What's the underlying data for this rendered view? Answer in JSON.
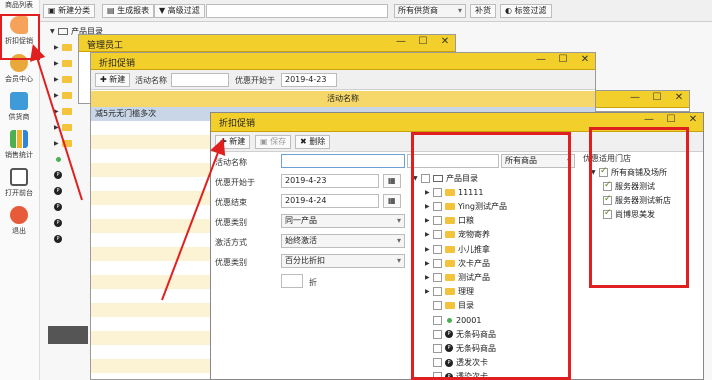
{
  "sidebar": {
    "items": [
      {
        "label": "商品列表",
        "icon": "goods-list-icon"
      },
      {
        "label": "折扣促销",
        "icon": "discount-tag-icon"
      },
      {
        "label": "会员中心",
        "icon": "member-icon"
      },
      {
        "label": "供货商",
        "icon": "supplier-icon"
      },
      {
        "label": "销售统计",
        "icon": "sales-chart-icon"
      },
      {
        "label": "打开前台",
        "icon": "pos-terminal-icon"
      },
      {
        "label": "退出",
        "icon": "power-icon"
      }
    ]
  },
  "main_toolbar": {
    "new_category": "新建分类",
    "generate_report": "生成报表",
    "advanced_filter": "高级过滤",
    "supplier_select": "所有供货商",
    "replenish": "补货",
    "tag_filter": "标签过滤"
  },
  "main_tree": {
    "root": "产品目录"
  },
  "staff_window": {
    "title": "管理员工"
  },
  "promo_window_back": {
    "title": "折扣促销",
    "new_button": "新建",
    "name_label": "活动名称",
    "start_label": "优惠开始于",
    "start_value": "2019-4-23",
    "column_header": "活动名称",
    "row1": "减5元无门槛多次"
  },
  "promo_window_front": {
    "title": "折扣促销",
    "new_button": "新建",
    "save_button": "保存",
    "delete_button": "删除",
    "form": {
      "name_label": "活动名称",
      "name_value": "",
      "start_label": "优惠开始于",
      "start_value": "2019-4-23",
      "end_label": "优惠结束",
      "end_value": "2019-4-24",
      "category_label": "优惠类别",
      "category_value": "同一产品",
      "activation_label": "激活方式",
      "activation_value": "始终激活",
      "type_label": "优惠类别",
      "type_value": "百分比折扣",
      "discount_unit": "折"
    },
    "product_filter": "所有商品",
    "product_tree": [
      {
        "label": "产品目录",
        "kind": "root"
      },
      {
        "label": "11111",
        "kind": "folder"
      },
      {
        "label": "Ying测试产品",
        "kind": "folder"
      },
      {
        "label": "口粮",
        "kind": "folder"
      },
      {
        "label": "宠物寄养",
        "kind": "folder"
      },
      {
        "label": "小儿推拿",
        "kind": "folder"
      },
      {
        "label": "次卡产品",
        "kind": "folder"
      },
      {
        "label": "测试产品",
        "kind": "folder"
      },
      {
        "label": "理理",
        "kind": "folder"
      },
      {
        "label": "目录",
        "kind": "folder-leaf"
      },
      {
        "label": "20001",
        "kind": "dot"
      },
      {
        "label": "无条码商品",
        "kind": "badge"
      },
      {
        "label": "无条码商品",
        "kind": "badge"
      },
      {
        "label": "透发次卡",
        "kind": "badge"
      },
      {
        "label": "透染次卡",
        "kind": "badge"
      }
    ],
    "store_panel": {
      "header": "优惠适用门店",
      "items": [
        {
          "label": "所有商铺及场所",
          "checked": true
        },
        {
          "label": "服务器测试",
          "checked": true
        },
        {
          "label": "服务器测试新店",
          "checked": true
        },
        {
          "label": "尚博思美发",
          "checked": true
        }
      ]
    }
  },
  "colors": {
    "titlebar": "#f2cf2a",
    "annotation": "#e02020",
    "stripe": "#fbf3d3"
  }
}
